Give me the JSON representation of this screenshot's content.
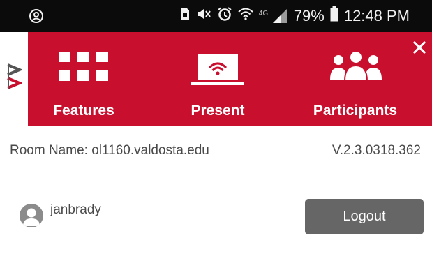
{
  "status_bar": {
    "battery_percent": "79%",
    "time": "12:48 PM",
    "network_label": "4G",
    "left_icon": "account-circle-icon",
    "icons": [
      "sim-card-icon",
      "mute-icon",
      "alarm-icon",
      "wifi-icon",
      "signal-icon",
      "battery-icon"
    ]
  },
  "logo": {
    "name": "via-logo-icon"
  },
  "toolbar": {
    "background": "#c8102e",
    "items": [
      {
        "label": "Features",
        "icon": "grid-icon"
      },
      {
        "label": "Present",
        "icon": "laptop-wifi-icon"
      },
      {
        "label": "Participants",
        "icon": "people-icon"
      }
    ],
    "close_icon": "close-icon"
  },
  "room": {
    "name_text": "Room Name: ol1160.valdosta.edu",
    "version": "V.2.3.0318.362"
  },
  "user": {
    "username": "janbrady",
    "avatar_icon": "user-avatar-icon",
    "logout_label": "Logout"
  }
}
